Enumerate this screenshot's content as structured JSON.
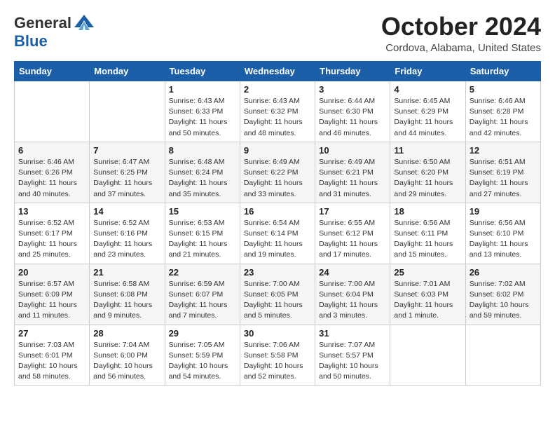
{
  "header": {
    "logo_general": "General",
    "logo_blue": "Blue",
    "month_title": "October 2024",
    "location": "Cordova, Alabama, United States"
  },
  "days_of_week": [
    "Sunday",
    "Monday",
    "Tuesday",
    "Wednesday",
    "Thursday",
    "Friday",
    "Saturday"
  ],
  "weeks": [
    [
      {
        "day": "",
        "sunrise": "",
        "sunset": "",
        "daylight": ""
      },
      {
        "day": "",
        "sunrise": "",
        "sunset": "",
        "daylight": ""
      },
      {
        "day": "1",
        "sunrise": "Sunrise: 6:43 AM",
        "sunset": "Sunset: 6:33 PM",
        "daylight": "Daylight: 11 hours and 50 minutes."
      },
      {
        "day": "2",
        "sunrise": "Sunrise: 6:43 AM",
        "sunset": "Sunset: 6:32 PM",
        "daylight": "Daylight: 11 hours and 48 minutes."
      },
      {
        "day": "3",
        "sunrise": "Sunrise: 6:44 AM",
        "sunset": "Sunset: 6:30 PM",
        "daylight": "Daylight: 11 hours and 46 minutes."
      },
      {
        "day": "4",
        "sunrise": "Sunrise: 6:45 AM",
        "sunset": "Sunset: 6:29 PM",
        "daylight": "Daylight: 11 hours and 44 minutes."
      },
      {
        "day": "5",
        "sunrise": "Sunrise: 6:46 AM",
        "sunset": "Sunset: 6:28 PM",
        "daylight": "Daylight: 11 hours and 42 minutes."
      }
    ],
    [
      {
        "day": "6",
        "sunrise": "Sunrise: 6:46 AM",
        "sunset": "Sunset: 6:26 PM",
        "daylight": "Daylight: 11 hours and 40 minutes."
      },
      {
        "day": "7",
        "sunrise": "Sunrise: 6:47 AM",
        "sunset": "Sunset: 6:25 PM",
        "daylight": "Daylight: 11 hours and 37 minutes."
      },
      {
        "day": "8",
        "sunrise": "Sunrise: 6:48 AM",
        "sunset": "Sunset: 6:24 PM",
        "daylight": "Daylight: 11 hours and 35 minutes."
      },
      {
        "day": "9",
        "sunrise": "Sunrise: 6:49 AM",
        "sunset": "Sunset: 6:22 PM",
        "daylight": "Daylight: 11 hours and 33 minutes."
      },
      {
        "day": "10",
        "sunrise": "Sunrise: 6:49 AM",
        "sunset": "Sunset: 6:21 PM",
        "daylight": "Daylight: 11 hours and 31 minutes."
      },
      {
        "day": "11",
        "sunrise": "Sunrise: 6:50 AM",
        "sunset": "Sunset: 6:20 PM",
        "daylight": "Daylight: 11 hours and 29 minutes."
      },
      {
        "day": "12",
        "sunrise": "Sunrise: 6:51 AM",
        "sunset": "Sunset: 6:19 PM",
        "daylight": "Daylight: 11 hours and 27 minutes."
      }
    ],
    [
      {
        "day": "13",
        "sunrise": "Sunrise: 6:52 AM",
        "sunset": "Sunset: 6:17 PM",
        "daylight": "Daylight: 11 hours and 25 minutes."
      },
      {
        "day": "14",
        "sunrise": "Sunrise: 6:52 AM",
        "sunset": "Sunset: 6:16 PM",
        "daylight": "Daylight: 11 hours and 23 minutes."
      },
      {
        "day": "15",
        "sunrise": "Sunrise: 6:53 AM",
        "sunset": "Sunset: 6:15 PM",
        "daylight": "Daylight: 11 hours and 21 minutes."
      },
      {
        "day": "16",
        "sunrise": "Sunrise: 6:54 AM",
        "sunset": "Sunset: 6:14 PM",
        "daylight": "Daylight: 11 hours and 19 minutes."
      },
      {
        "day": "17",
        "sunrise": "Sunrise: 6:55 AM",
        "sunset": "Sunset: 6:12 PM",
        "daylight": "Daylight: 11 hours and 17 minutes."
      },
      {
        "day": "18",
        "sunrise": "Sunrise: 6:56 AM",
        "sunset": "Sunset: 6:11 PM",
        "daylight": "Daylight: 11 hours and 15 minutes."
      },
      {
        "day": "19",
        "sunrise": "Sunrise: 6:56 AM",
        "sunset": "Sunset: 6:10 PM",
        "daylight": "Daylight: 11 hours and 13 minutes."
      }
    ],
    [
      {
        "day": "20",
        "sunrise": "Sunrise: 6:57 AM",
        "sunset": "Sunset: 6:09 PM",
        "daylight": "Daylight: 11 hours and 11 minutes."
      },
      {
        "day": "21",
        "sunrise": "Sunrise: 6:58 AM",
        "sunset": "Sunset: 6:08 PM",
        "daylight": "Daylight: 11 hours and 9 minutes."
      },
      {
        "day": "22",
        "sunrise": "Sunrise: 6:59 AM",
        "sunset": "Sunset: 6:07 PM",
        "daylight": "Daylight: 11 hours and 7 minutes."
      },
      {
        "day": "23",
        "sunrise": "Sunrise: 7:00 AM",
        "sunset": "Sunset: 6:05 PM",
        "daylight": "Daylight: 11 hours and 5 minutes."
      },
      {
        "day": "24",
        "sunrise": "Sunrise: 7:00 AM",
        "sunset": "Sunset: 6:04 PM",
        "daylight": "Daylight: 11 hours and 3 minutes."
      },
      {
        "day": "25",
        "sunrise": "Sunrise: 7:01 AM",
        "sunset": "Sunset: 6:03 PM",
        "daylight": "Daylight: 11 hours and 1 minute."
      },
      {
        "day": "26",
        "sunrise": "Sunrise: 7:02 AM",
        "sunset": "Sunset: 6:02 PM",
        "daylight": "Daylight: 10 hours and 59 minutes."
      }
    ],
    [
      {
        "day": "27",
        "sunrise": "Sunrise: 7:03 AM",
        "sunset": "Sunset: 6:01 PM",
        "daylight": "Daylight: 10 hours and 58 minutes."
      },
      {
        "day": "28",
        "sunrise": "Sunrise: 7:04 AM",
        "sunset": "Sunset: 6:00 PM",
        "daylight": "Daylight: 10 hours and 56 minutes."
      },
      {
        "day": "29",
        "sunrise": "Sunrise: 7:05 AM",
        "sunset": "Sunset: 5:59 PM",
        "daylight": "Daylight: 10 hours and 54 minutes."
      },
      {
        "day": "30",
        "sunrise": "Sunrise: 7:06 AM",
        "sunset": "Sunset: 5:58 PM",
        "daylight": "Daylight: 10 hours and 52 minutes."
      },
      {
        "day": "31",
        "sunrise": "Sunrise: 7:07 AM",
        "sunset": "Sunset: 5:57 PM",
        "daylight": "Daylight: 10 hours and 50 minutes."
      },
      {
        "day": "",
        "sunrise": "",
        "sunset": "",
        "daylight": ""
      },
      {
        "day": "",
        "sunrise": "",
        "sunset": "",
        "daylight": ""
      }
    ]
  ]
}
